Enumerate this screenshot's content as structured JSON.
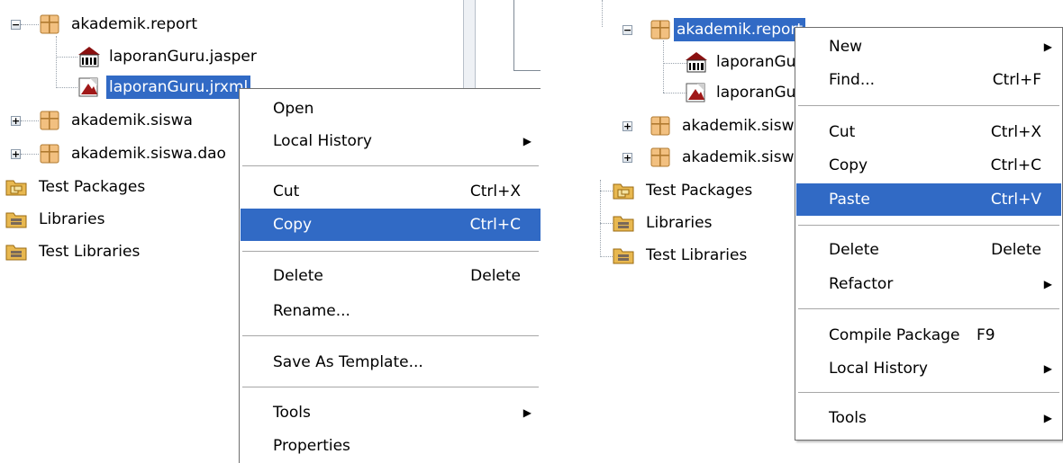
{
  "left": {
    "tree": {
      "package_report": "akademik.report",
      "file_jasper": "laporanGuru.jasper",
      "file_jrxml": "laporanGuru.jrxml",
      "package_siswa": "akademik.siswa",
      "package_siswa_dao": "akademik.siswa.dao",
      "test_packages": "Test Packages",
      "libraries": "Libraries",
      "test_libraries": "Test Libraries"
    },
    "menu": {
      "open": "Open",
      "local_history": "Local History",
      "cut": "Cut",
      "cut_shortcut": "Ctrl+X",
      "copy": "Copy",
      "copy_shortcut": "Ctrl+C",
      "delete": "Delete",
      "delete_shortcut": "Delete",
      "rename": "Rename...",
      "save_as_template": "Save As Template...",
      "tools": "Tools",
      "properties": "Properties"
    }
  },
  "right": {
    "tree": {
      "package_report": "akademik.report",
      "file_jasper": "laporanGuru.jasper",
      "file_jrxml": "laporanGuru.jrxml",
      "package_siswa": "akademik.siswa",
      "package_siswa_dao": "akademik.siswa.dao",
      "test_packages": "Test Packages",
      "libraries": "Libraries",
      "test_libraries": "Test Libraries"
    },
    "menu": {
      "new": "New",
      "find": "Find...",
      "find_shortcut": "Ctrl+F",
      "cut": "Cut",
      "cut_shortcut": "Ctrl+X",
      "copy": "Copy",
      "copy_shortcut": "Ctrl+C",
      "paste": "Paste",
      "paste_shortcut": "Ctrl+V",
      "delete": "Delete",
      "delete_shortcut": "Delete",
      "refactor": "Refactor",
      "compile_package": "Compile Package",
      "compile_shortcut": "F9",
      "local_history": "Local History",
      "tools": "Tools"
    }
  },
  "icons": {
    "submenu_arrow": "▶",
    "expand": "+",
    "collapse": "−"
  },
  "colors": {
    "selection": "#316ac5",
    "package_icon": "#e8b060",
    "folder_icon": "#e8c070"
  }
}
